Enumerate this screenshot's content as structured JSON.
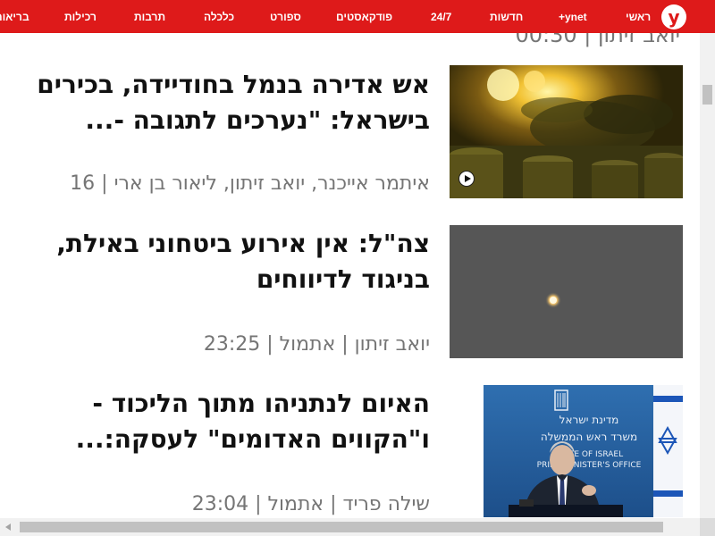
{
  "brand": {
    "logo_letter": "y",
    "primary_color": "#de1a1a"
  },
  "nav": {
    "items": [
      {
        "label": "ראשי"
      },
      {
        "label": "+ynet"
      },
      {
        "label": "חדשות"
      },
      {
        "label": "24/7"
      },
      {
        "label": "פודקאסטים"
      },
      {
        "label": "ספורט"
      },
      {
        "label": "כלכלה"
      },
      {
        "label": "תרבות"
      },
      {
        "label": "רכילות"
      },
      {
        "label": "בריאות"
      }
    ]
  },
  "feed": {
    "partial_top_byline": "יואב זיתון | 00:30",
    "articles": [
      {
        "headline": "אש אדירה בנמל בחודיידה, בכירים בישראל: \"נערכים לתגובה -...",
        "byline": "איתמר אייכנר, יואב זיתון, ליאור בן ארי | 16",
        "image_icon": "fire-port-image",
        "has_video": true
      },
      {
        "headline": "צה\"ל: אין אירוע ביטחוני באילת, בניגוד לדיווחים",
        "byline": "יואב זיתון | אתמול | 23:25",
        "image_icon": "night-sky-light-image",
        "has_video": false
      },
      {
        "headline": "האיום לנתניהו מתוך הליכוד - ו\"הקווים האדומים\" לעסקה:...",
        "byline": "שילה פריד | אתמול | 23:04",
        "image_icon": "netanyahu-podium-image",
        "image_text": {
          "line1": "מדינת ישראל",
          "line2": "משרד ראש הממשלה",
          "line3": "STATE OF ISRAEL",
          "line4": "PRIME MINISTER'S OFFICE"
        },
        "has_video": true
      }
    ]
  }
}
